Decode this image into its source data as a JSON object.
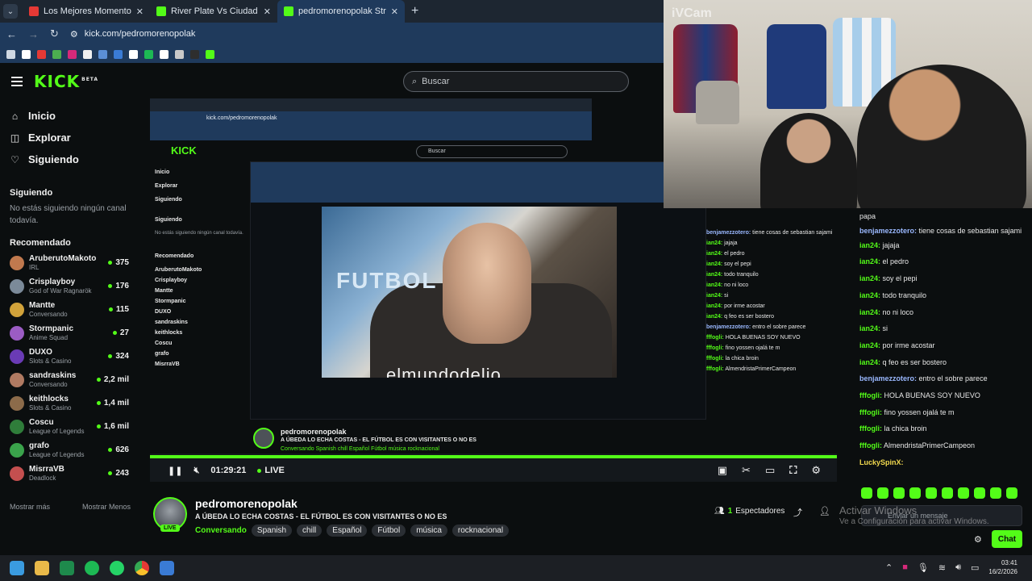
{
  "browser": {
    "tabs": [
      {
        "title": "Los Mejores Momentos de Hon",
        "color": "#e53935"
      },
      {
        "title": "River Plate Vs Ciudad De Boliv",
        "color": "#53fc18"
      },
      {
        "title": "pedromorenopolak Stream - W",
        "color": "#53fc18"
      }
    ],
    "url": "kick.com/pedromorenopolak"
  },
  "kick": {
    "logo": "KICK",
    "logo_sup": "BETA",
    "search_placeholder": "Buscar"
  },
  "sidebar": {
    "nav": [
      {
        "label": "Inicio",
        "icon": "home-icon",
        "glyph": "⌂"
      },
      {
        "label": "Explorar",
        "icon": "explore-icon",
        "glyph": "◫"
      },
      {
        "label": "Siguiendo",
        "icon": "heart-icon",
        "glyph": "♡"
      }
    ],
    "following_heading": "Siguiendo",
    "following_empty": "No estás siguiendo ningún canal todavía.",
    "recommended_heading": "Recomendado",
    "recommended": [
      {
        "name": "AruberutoMakoto",
        "category": "IRL",
        "viewers": "375",
        "color": "#c0794e"
      },
      {
        "name": "Crisplayboy",
        "category": "God of War Ragnarök",
        "viewers": "176",
        "color": "#7b8a99"
      },
      {
        "name": "Mantte",
        "category": "Conversando",
        "viewers": "115",
        "color": "#d1a23a"
      },
      {
        "name": "Stormpanic",
        "category": "Anime Squad",
        "viewers": "27",
        "color": "#9b5cc4"
      },
      {
        "name": "DUXO",
        "category": "Slots & Casino",
        "viewers": "324",
        "color": "#6a3bb5"
      },
      {
        "name": "sandraskins",
        "category": "Conversando",
        "viewers": "2,2 mil",
        "color": "#b07a62"
      },
      {
        "name": "keithlocks",
        "category": "Slots & Casino",
        "viewers": "1,4 mil",
        "color": "#8c6b4a"
      },
      {
        "name": "Coscu",
        "category": "League of Legends",
        "viewers": "1,6 mil",
        "color": "#2f7d3a"
      },
      {
        "name": "grafo",
        "category": "League of Legends",
        "viewers": "626",
        "color": "#3aa34b"
      },
      {
        "name": "MisrraVB",
        "category": "Deadlock",
        "viewers": "243",
        "color": "#c44f4f"
      }
    ],
    "show_more": "Mostrar más",
    "show_less": "Mostrar Menos"
  },
  "player": {
    "time": "01:29:21",
    "live_label": "LIVE",
    "nested": {
      "url": "kick.com/pedromorenopolak",
      "search": "Buscar",
      "logo": "KICK",
      "nav": [
        "Inicio",
        "Explorar",
        "Siguiendo"
      ],
      "following_heading": "Siguiendo",
      "following_empty": "No estás siguiendo ningún canal todavía.",
      "recommended_heading": "Recomendado",
      "recommended": [
        "AruberutoMakoto",
        "Crisplayboy",
        "Mantte",
        "Stormpanic",
        "DUXO",
        "sandraskins",
        "keithlocks",
        "Coscu",
        "grafo",
        "MisrraVB"
      ],
      "video_text_futbol": "FUTBOL",
      "video_text_caption": "elmundodelio",
      "channel": "pedromorenopolak",
      "title": "A ÚBEDA LO ECHA COSTAS - EL FÚTBOL ES CON VISITANTES O NO ES",
      "tags": "Conversando  Spanish  chill  Español  Fútbol  música  rocknacional"
    }
  },
  "webcam": {
    "label": "iVCam"
  },
  "stream": {
    "channel": "pedromorenopolak",
    "live_badge": "LIVE",
    "title": "A ÚBEDA LO ECHA COSTAS - EL FÚTBOL ES CON VISITANTES O NO ES",
    "category": "Conversando",
    "tags": [
      "Spanish",
      "chill",
      "Español",
      "Fútbol",
      "música",
      "rocknacional"
    ],
    "viewers": "1",
    "viewers_label": "Espectadores"
  },
  "chat": {
    "messages": [
      {
        "user": "",
        "text": "papa",
        "color": "#e8e8e8"
      },
      {
        "user": "benjamezzotero:",
        "text": " tiene cosas de sebastian sajami",
        "color": "#9ab8ff",
        "wrap": true
      },
      {
        "user": "ian24:",
        "text": " jajaja",
        "color": "#53fc18"
      },
      {
        "user": "ian24:",
        "text": " el pedro",
        "color": "#53fc18"
      },
      {
        "user": "ian24:",
        "text": " soy el pepi",
        "color": "#53fc18"
      },
      {
        "user": "ian24:",
        "text": " todo tranquilo",
        "color": "#53fc18"
      },
      {
        "user": "ian24:",
        "text": " no ni loco",
        "color": "#53fc18"
      },
      {
        "user": "ian24:",
        "text": " si",
        "color": "#53fc18"
      },
      {
        "user": "ian24:",
        "text": " por irme acostar",
        "color": "#53fc18"
      },
      {
        "user": "ian24:",
        "text": " q feo es ser bostero",
        "color": "#53fc18"
      },
      {
        "user": "benjamezzotero:",
        "text": " entro el sobre parece",
        "color": "#9ab8ff"
      },
      {
        "user": "fffogli:",
        "text": " HOLA BUENAS SOY NUEVO",
        "color": "#53fc18"
      },
      {
        "user": "fffogli:",
        "text": " fino yossen ojalá te m",
        "color": "#53fc18"
      },
      {
        "user": "fffogli:",
        "text": " la chica broin",
        "color": "#53fc18"
      },
      {
        "user": "fffogli:",
        "text": " AlmendristaPrimerCampeon",
        "color": "#53fc18"
      },
      {
        "user": "LuckySpinX:",
        "text": "",
        "color": "#f2d94e"
      }
    ],
    "input_placeholder": "Enviar un mensaje",
    "send_label": "Chat",
    "watermark_title": "Activar Windows",
    "watermark_sub": "Ve a Configuración para activar Windows."
  },
  "taskbar": {
    "time": "03:41",
    "date": "16/2/2026"
  }
}
